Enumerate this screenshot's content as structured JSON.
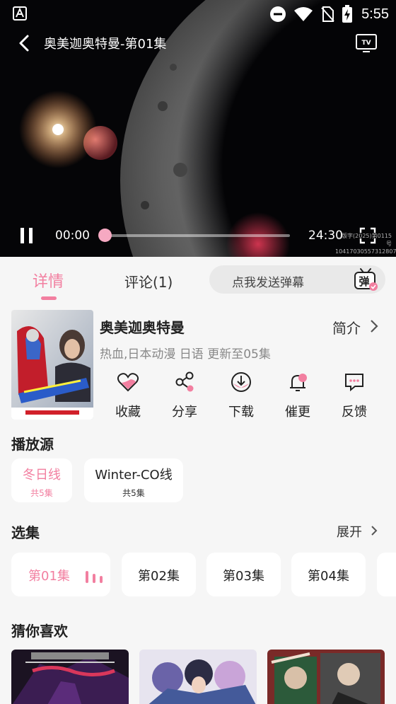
{
  "status_bar": {
    "time": "5:55"
  },
  "player": {
    "title": "奥美迦奥特曼-第01集",
    "current_time": "00:00",
    "total_time": "24:30",
    "progress": 0,
    "license_line1": "...版字(2025)第0115号",
    "license_line2": "10417030557312807"
  },
  "tabs": {
    "detail": "详情",
    "comments": "评论(1)"
  },
  "danmaku": {
    "placeholder": "点我发送弹幕",
    "icon_text": "弹"
  },
  "info": {
    "title": "奥美迦奥特曼",
    "intro": "简介",
    "meta": "热血,日本动漫 日语 更新至05集"
  },
  "actions": [
    {
      "label": "收藏",
      "icon": "heart-icon"
    },
    {
      "label": "分享",
      "icon": "share-icon"
    },
    {
      "label": "下载",
      "icon": "download-icon"
    },
    {
      "label": "催更",
      "icon": "bell-icon"
    },
    {
      "label": "反馈",
      "icon": "feedback-icon"
    }
  ],
  "sources": {
    "heading": "播放源",
    "items": [
      {
        "name": "冬日线",
        "count": "共5集",
        "active": true
      },
      {
        "name": "Winter-CO线",
        "count": "共5集",
        "active": false
      }
    ]
  },
  "episodes": {
    "heading": "选集",
    "expand": "展开",
    "items": [
      "第01集",
      "第02集",
      "第03集",
      "第04集"
    ],
    "active_index": 0
  },
  "recommend": {
    "heading": "猜你喜欢"
  },
  "colors": {
    "accent": "#f27fa0",
    "background": "#f6f6f6"
  }
}
